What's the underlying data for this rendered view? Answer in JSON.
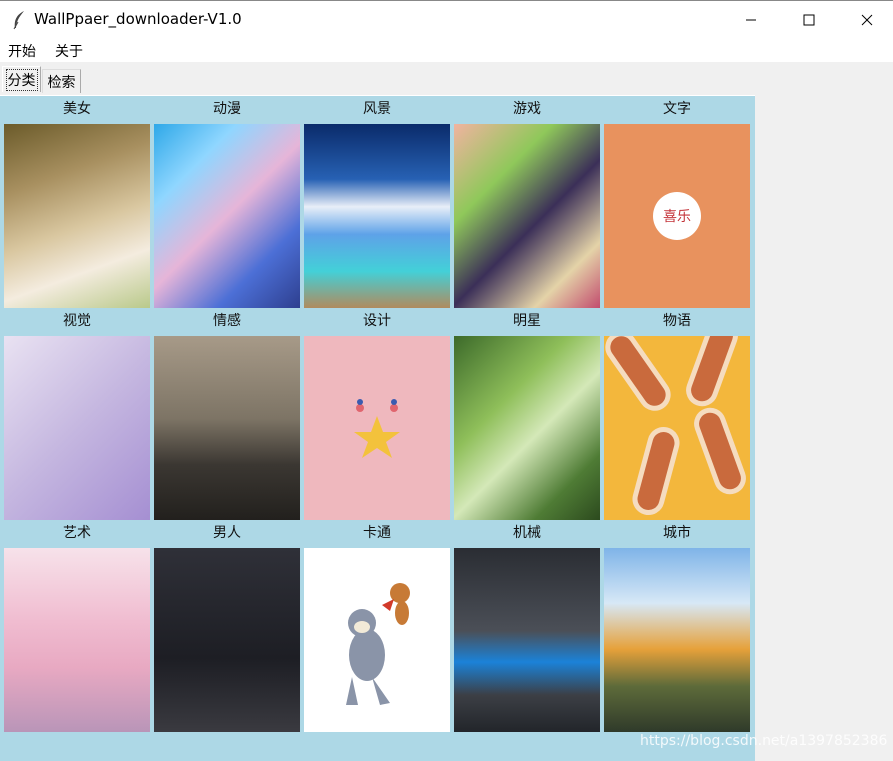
{
  "window": {
    "title": "WallPpaer_downloader-V1.0",
    "app_icon": "feather-icon",
    "controls": [
      "minimize-icon",
      "maximize-icon",
      "close-icon"
    ]
  },
  "menu": {
    "items": [
      {
        "label": "开始"
      },
      {
        "label": "关于"
      }
    ]
  },
  "tabs": [
    {
      "label": "分类",
      "active": true
    },
    {
      "label": "检索",
      "active": false
    }
  ],
  "categories": [
    {
      "label": "美女"
    },
    {
      "label": "动漫"
    },
    {
      "label": "风景"
    },
    {
      "label": "游戏"
    },
    {
      "label": "文字",
      "thumb_text": "喜乐"
    },
    {
      "label": "视觉"
    },
    {
      "label": "情感"
    },
    {
      "label": "设计"
    },
    {
      "label": "明星"
    },
    {
      "label": "物语"
    },
    {
      "label": "艺术"
    },
    {
      "label": "男人"
    },
    {
      "label": "卡通"
    },
    {
      "label": "机械"
    },
    {
      "label": "城市"
    }
  ],
  "colors": {
    "panel_bg": "#add8e6",
    "tab_bg": "#f0f0f0"
  },
  "watermark": "https://blog.csdn.net/a1397852386"
}
